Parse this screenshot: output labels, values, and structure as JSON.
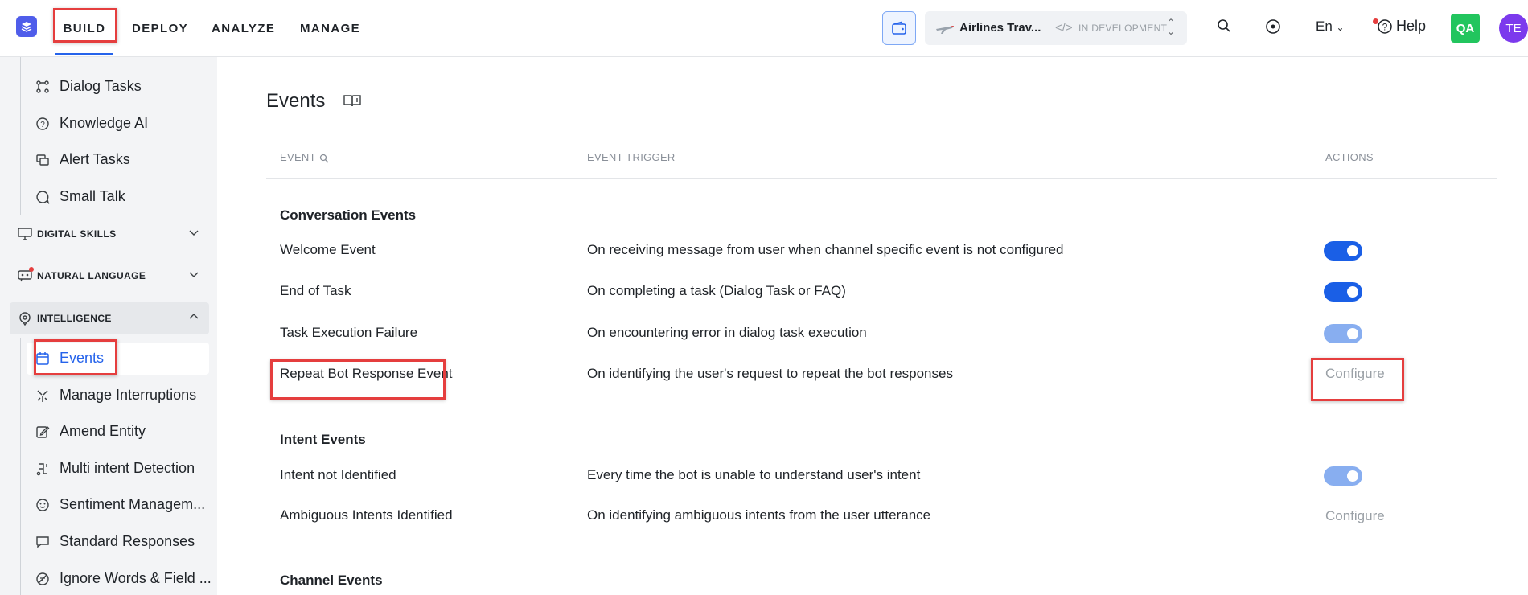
{
  "nav": {
    "items": [
      "BUILD",
      "DEPLOY",
      "ANALYZE",
      "MANAGE"
    ]
  },
  "app": {
    "name": "Airlines Trav...",
    "code_glyph": "</>",
    "status": "IN DEVELOPMENT"
  },
  "header": {
    "language": "En",
    "help": "Help",
    "qa_badge": "QA",
    "avatar": "TE"
  },
  "sidebar": {
    "items_top": [
      "Dialog Tasks",
      "Knowledge AI",
      "Alert Tasks",
      "Small Talk"
    ],
    "sections": [
      "DIGITAL SKILLS",
      "NATURAL LANGUAGE",
      "INTELLIGENCE"
    ],
    "items_intelligence": [
      "Events",
      "Manage Interruptions",
      "Amend Entity",
      "Multi intent Detection",
      "Sentiment Managem...",
      "Standard Responses",
      "Ignore Words & Field ..."
    ]
  },
  "page": {
    "title": "Events",
    "columns": {
      "event": "EVENT",
      "trigger": "EVENT TRIGGER",
      "actions": "ACTIONS"
    },
    "groups": [
      {
        "title": "Conversation Events",
        "events": [
          {
            "name": "Welcome Event",
            "trigger": "On receiving message from user when channel specific event is not configured",
            "action": "toggle",
            "state": "on"
          },
          {
            "name": "End of Task",
            "trigger": "On completing a task (Dialog Task or FAQ)",
            "action": "toggle",
            "state": "on"
          },
          {
            "name": "Task Execution Failure",
            "trigger": "On encountering error in dialog task execution",
            "action": "toggle",
            "state": "on-disabled"
          },
          {
            "name": "Repeat Bot Response Event",
            "trigger": "On identifying the user's request to repeat the bot responses",
            "action": "Configure"
          }
        ]
      },
      {
        "title": "Intent Events",
        "events": [
          {
            "name": "Intent not Identified",
            "trigger": "Every time the bot is unable to understand user's intent",
            "action": "toggle",
            "state": "on-disabled"
          },
          {
            "name": "Ambiguous Intents Identified",
            "trigger": "On identifying ambiguous intents from the user utterance",
            "action": "Configure"
          }
        ]
      },
      {
        "title": "Channel Events",
        "events": []
      }
    ]
  },
  "colors": {
    "accent": "#1a5fe6",
    "accent_disabled": "#88aef0",
    "highlight": "#e53e3e",
    "logo": "#4f5dea",
    "qa_badge": "#22c55e",
    "avatar": "#7c3aed"
  }
}
